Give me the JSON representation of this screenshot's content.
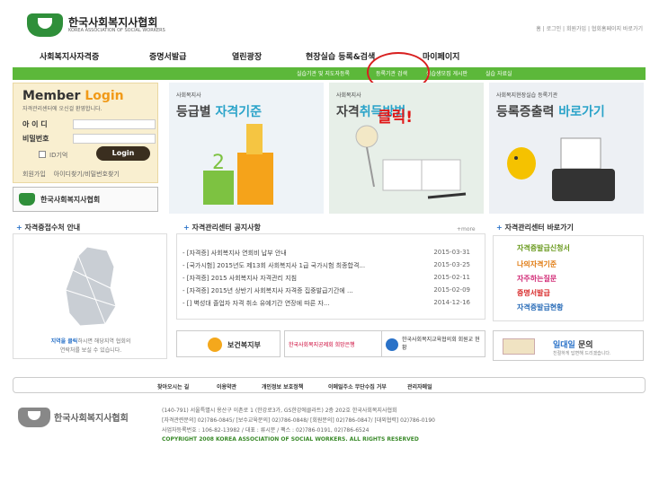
{
  "header": {
    "org_name": "한국사회복지사협회",
    "org_en": "KOREA ASSOCIATION OF SOCIAL WORKERS",
    "top_links": "홈 | 로그인 | 회원가입 | 협회홈페이지 바로가기"
  },
  "nav": {
    "items": [
      "사회복지사자격증",
      "증명서발급",
      "열린광장",
      "현장실습 등록&검색",
      "마이페이지"
    ]
  },
  "subnav": {
    "items": [
      "실습기관 및 지도자등록",
      "등록기관 검색",
      "실습생모집 게시판",
      "실습 자료실"
    ]
  },
  "member": {
    "title_a": "Member",
    "title_b": "Login",
    "subtitle": "자격관리센터에 오신걸 환영합니다.",
    "id_label": "아 이 디",
    "pw_label": "비밀번호",
    "remember": "ID기억",
    "login_btn": "Login",
    "join": "회원가입",
    "find": "아이디찾기/비밀번호찾기"
  },
  "side_logo": "한국사회복지사협회",
  "banners": [
    {
      "small": "사회복지사",
      "big_a": "등급별 ",
      "big_b": "자격기준"
    },
    {
      "small": "사회복지사",
      "big_a": "자격",
      "big_b": "취득방법"
    },
    {
      "small": "사회복지현장실습 등록기관",
      "big_a": "등록증출력 ",
      "big_b": "바로가기"
    }
  ],
  "click_label": "클릭!",
  "sections": {
    "map": "자격증접수처 안내",
    "notice": "자격관리센터 공지사항",
    "more": "+more",
    "quick": "자격관리센터 바로가기"
  },
  "map_caption_a": "지역을 클릭",
  "map_caption_b": "하시면 해당지역 협회의",
  "map_caption_c": "연락처를 보실 수 있습니다.",
  "notices": [
    {
      "title": "- [자격증] 사회복지사 연회비 납부 안내",
      "date": "2015-03-31"
    },
    {
      "title": "- [국가시험] 2015년도 제13회 사회복지사 1급 국가시험 최종합격...",
      "date": "2015-03-25"
    },
    {
      "title": "- [자격증] 2015 사회복지사 자격관리 지침",
      "date": "2015-02-11"
    },
    {
      "title": "- [자격증] 2015년 상반기 사회복지사 자격증 집중발급기간에 ...",
      "date": "2015-02-09"
    },
    {
      "title": "- [] 벽성대 졸업자 자격 취소 유예기간 연장에 따른 자...",
      "date": "2014-12-16"
    }
  ],
  "quick_links": [
    "자격증발급신청서",
    "나의자격기준",
    "자주하는질문",
    "증명서발급",
    "자격증발급현황"
  ],
  "quick_colors": [
    "#6a9a1f",
    "#e07b12",
    "#d22d78",
    "#d82b2b",
    "#2b6db8"
  ],
  "partners": [
    "보건복지부",
    "한국사회복지공제회 희망은행",
    "한국사회복지교육협의회 회원교 현황"
  ],
  "one_to_one": {
    "title_a": "일대일",
    "title_b": " 문의",
    "sub": "친절하게 답변해 드리겠습니다."
  },
  "footer": {
    "links": [
      "찾아오시는 길",
      "이용약관",
      "개인정보 보호정책",
      "이메일주소 무단수집 거부",
      "관리자메일"
    ],
    "org_name": "한국사회복지사협회",
    "addr": "(140-791) 서울특별시 용산구 이촌로 1 (한강로3가, GS한강에클라트) 2층 202호 한국사회복지사협회",
    "phones": "[자격관련문의] 02)786-0845/ [보수교육문의] 02)786-0848/ [회원문의] 02)786-0847/ [대외협력] 02)786-0190",
    "biz": "사업자등록번호 : 106-82-13982 / 대표 : 류시문 / 팩스 : 02)786-0191, 02)786-6524",
    "copy": "COPYRIGHT 2008 KOREA ASSOCIATION OF SOCIAL WORKERS. ALL RIGHTS RESERVED"
  }
}
